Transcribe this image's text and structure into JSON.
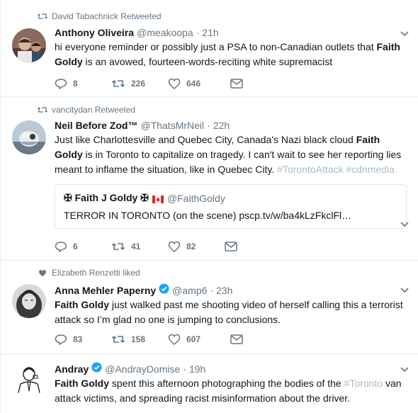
{
  "tweets": [
    {
      "context": "David Tabachnick Retweeted",
      "context_icon": "retweet-icon",
      "name": "Anthony Oliveira",
      "handle": "@meakoopa",
      "sep": "·",
      "time": "21h",
      "text_a": "hi everyone reminder or possibly just a PSA to non-Canadian outlets that ",
      "text_bold": "Faith Goldy",
      "text_b": " is an avowed, fourteen-words-reciting white supremacist",
      "replies": "8",
      "retweets": "226",
      "likes": "646"
    },
    {
      "context": "vancitydan Retweeted",
      "context_icon": "retweet-icon",
      "name": "Neil Before Zod™",
      "handle": "@ThatsMrNeil",
      "sep": "·",
      "time": "22h",
      "text_a": "Just like Charlottesville and Quebec City, Canada's Nazi black cloud ",
      "text_bold": "Faith Goldy",
      "text_b": " is in Toronto to capitalize on tragedy. I can't wait to see her reporting lies meant to inflame the situation, like in Quebec City. ",
      "hashtag1": "#TorontoAttack",
      "hashtag2": "#cdnmedia",
      "quote": {
        "name": "✠ Faith J Goldy ✠",
        "handle": "@FaithGoldy",
        "text": "TERROR IN TORONTO (on the scene)  pscp.tv/w/ba4kLzFkclFl…"
      },
      "replies": "6",
      "retweets": "41",
      "likes": "82"
    },
    {
      "context": "Elizabeth Renzetti liked",
      "context_icon": "heart-icon",
      "name": "Anna Mehler Paperny",
      "handle": "@amp6",
      "sep": "·",
      "time": "23h",
      "text_bold": "Faith Goldy",
      "text_b": " just walked past me shooting video of herself calling this a terrorist attack so I’m glad no one is jumping to conclusions.",
      "replies": "83",
      "retweets": "158",
      "likes": "607"
    },
    {
      "name": "Andray",
      "handle": "@AndrayDomise",
      "sep": "·",
      "time": "19h",
      "text_bold": "Faith Goldy",
      "text_b": " spent this afternoon photographing the bodies of the ",
      "hashtag": "#Toronto",
      "text_c": " van attack victims, and spreading racist misinformation about the driver."
    }
  ],
  "colors": {
    "verified": "#1da1f2",
    "muted": "#657786",
    "hashtag": "#a9bcc9",
    "border": "#e6ecf0"
  }
}
